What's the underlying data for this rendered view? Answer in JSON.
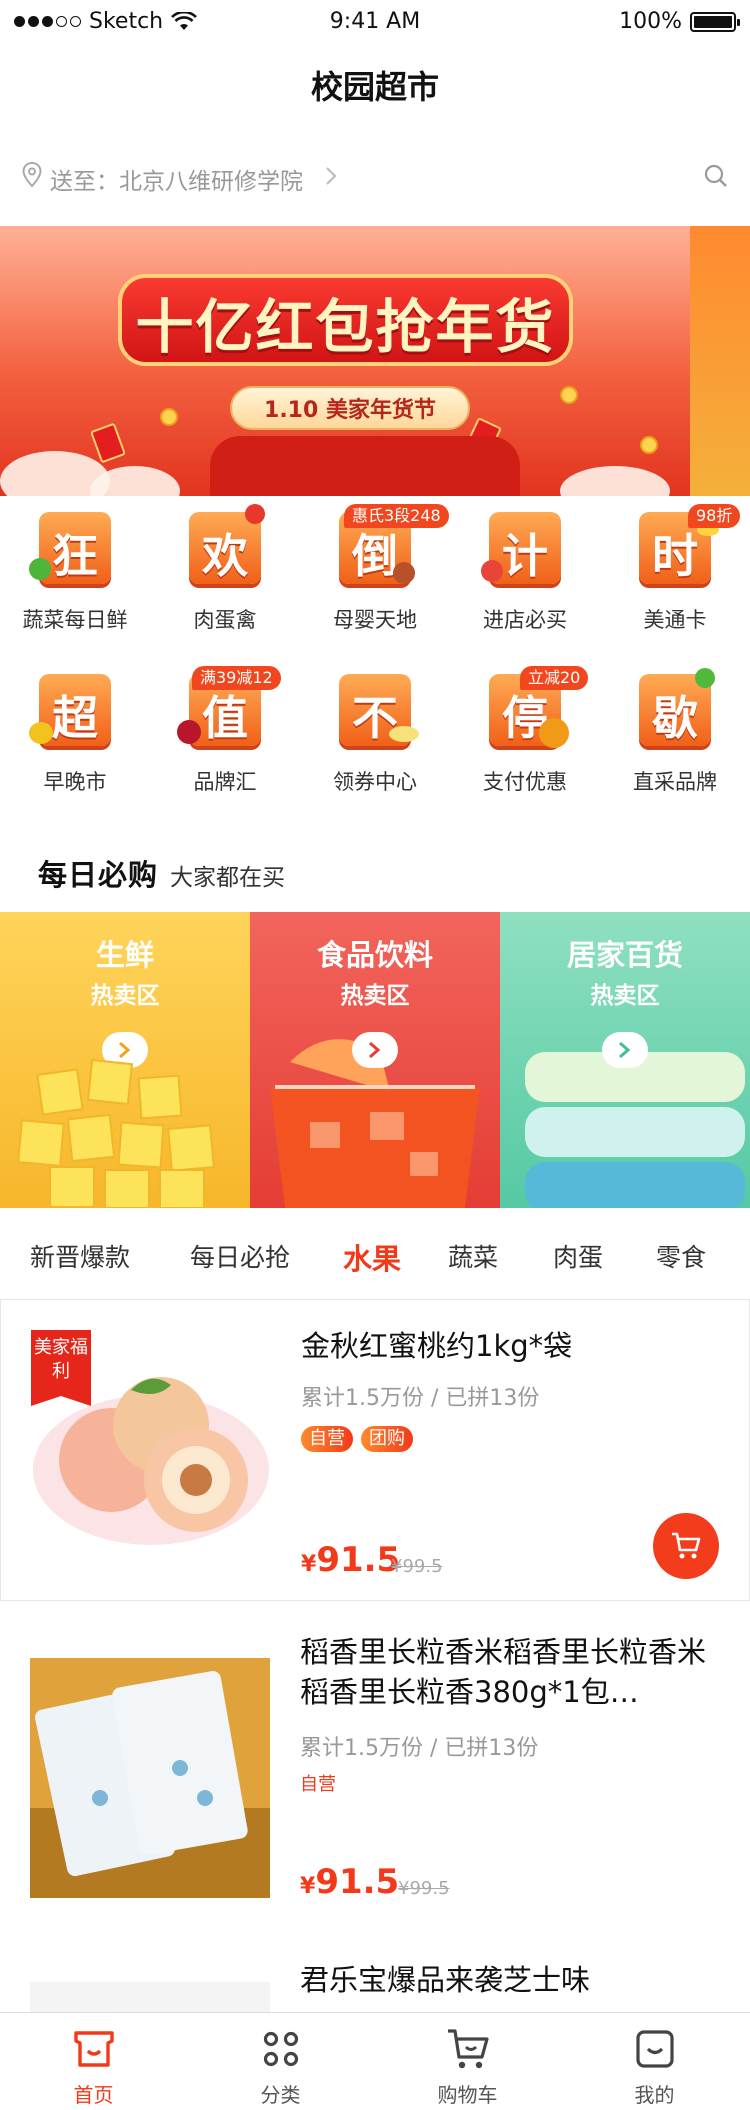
{
  "status_bar": {
    "carrier": "Sketch",
    "time": "9:41 AM",
    "battery": "100%"
  },
  "nav": {
    "title": "校园超市"
  },
  "address": {
    "prefix": "送至：",
    "location": "北京八维研修学院"
  },
  "banner": {
    "slogan": "十亿红包抢年货",
    "subtitle": "1.10 美家年货节"
  },
  "icon_grid": [
    {
      "char": "狂",
      "label": "蔬菜每日鲜",
      "badge": ""
    },
    {
      "char": "欢",
      "label": "肉蛋禽",
      "badge": ""
    },
    {
      "char": "倒",
      "label": "母婴天地",
      "badge": "惠氏3段248"
    },
    {
      "char": "计",
      "label": "进店必买",
      "badge": ""
    },
    {
      "char": "时",
      "label": "美通卡",
      "badge": "98折"
    },
    {
      "char": "超",
      "label": "早晚市",
      "badge": ""
    },
    {
      "char": "值",
      "label": "品牌汇",
      "badge": "满39减12"
    },
    {
      "char": "不",
      "label": "领券中心",
      "badge": ""
    },
    {
      "char": "停",
      "label": "支付优惠",
      "badge": "立减20"
    },
    {
      "char": "歇",
      "label": "直采品牌",
      "badge": ""
    }
  ],
  "daily": {
    "title": "每日必购",
    "subtitle": "大家都在买"
  },
  "categories": [
    {
      "title": "生鲜",
      "subtitle": "热卖区"
    },
    {
      "title": "食品饮料",
      "subtitle": "热卖区"
    },
    {
      "title": "居家百货",
      "subtitle": "热卖区"
    }
  ],
  "tabs": [
    "新晋爆款",
    "每日必抢",
    "水果",
    "蔬菜",
    "肉蛋",
    "零食"
  ],
  "active_tab": "水果",
  "products": [
    {
      "ribbon": "美家福利",
      "title": "金秋红蜜桃约1kg*袋",
      "meta": "累计1.5万份 / 已拼13份",
      "tags": [
        "自营",
        "团购"
      ],
      "currency": "¥",
      "price": "91.5",
      "old_price": "¥99.5"
    },
    {
      "ribbon": "",
      "title": "稻香里长粒香米稻香里长粒香米稻香里长粒香380g*1包…",
      "meta": "累计1.5万份 / 已拼13份",
      "tags": [
        "自营"
      ],
      "currency": "¥",
      "price": "91.5",
      "old_price": "¥99.5"
    },
    {
      "ribbon": "",
      "title": "君乐宝爆品来袭芝士味"
    }
  ],
  "tabbar": [
    {
      "label": "首页",
      "icon": "home-icon",
      "active": true
    },
    {
      "label": "分类",
      "icon": "category-icon",
      "active": false
    },
    {
      "label": "购物车",
      "icon": "cart-icon",
      "active": false
    },
    {
      "label": "我的",
      "icon": "profile-icon",
      "active": false
    }
  ],
  "colors": {
    "accent": "#f2391a",
    "tile": "#f06018"
  }
}
